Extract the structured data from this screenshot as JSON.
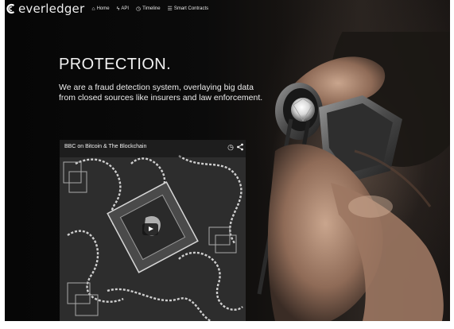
{
  "brand": {
    "name": "everledger",
    "logo_icon": "everledger-logo-icon"
  },
  "nav": {
    "items": [
      {
        "label": "Home",
        "icon": "home-icon",
        "glyph": "⌂"
      },
      {
        "label": "API",
        "icon": "bolt-icon",
        "glyph": "ϟ"
      },
      {
        "label": "Timeline",
        "icon": "clock-icon",
        "glyph": "◷"
      },
      {
        "label": "Smart Contracts",
        "icon": "contract-icon",
        "glyph": "☰"
      }
    ]
  },
  "hero": {
    "title": "PROTECTION.",
    "text": "We are a fraud detection system, overlaying big data from closed sources like insurers and law enforcement."
  },
  "video": {
    "title": "BBC on Bitcoin & The Blockchain",
    "clock_icon": "watch-later-icon",
    "share_icon": "share-icon",
    "play_icon": "play-icon"
  },
  "colors": {
    "background": "#0b0b0b",
    "text": "#f2f2f2",
    "video_bg": "#2b2b2b"
  }
}
